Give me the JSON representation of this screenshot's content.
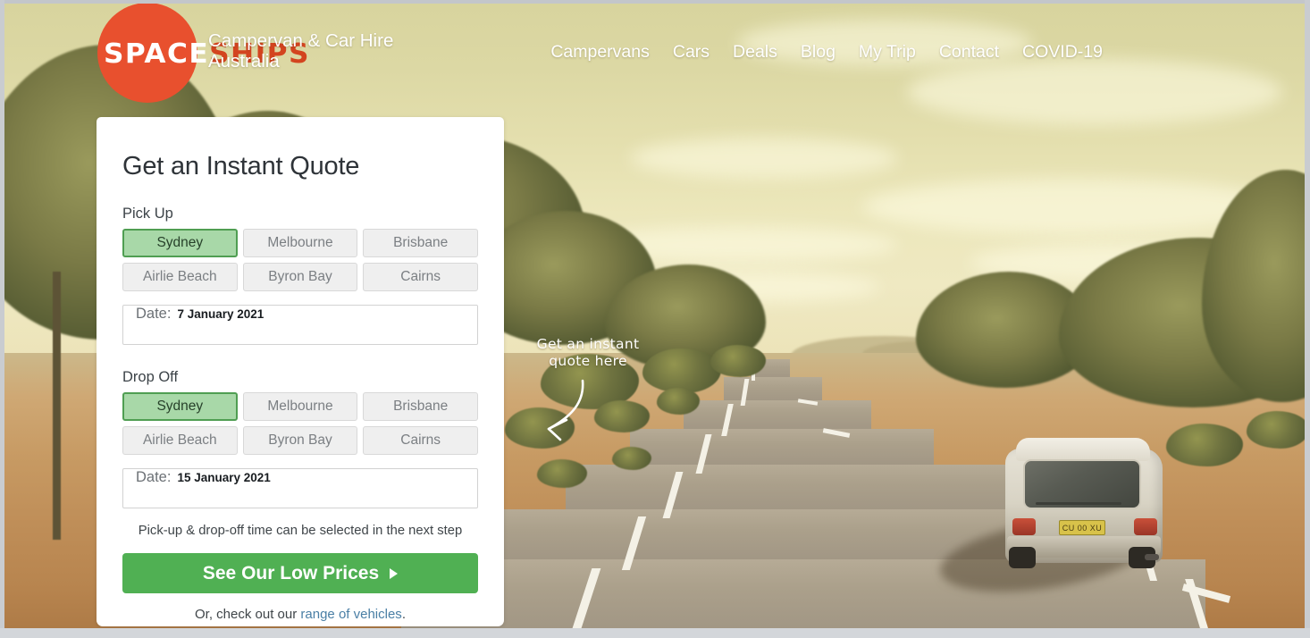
{
  "header": {
    "logo": {
      "word_primary": "SPACE",
      "word_secondary": "SHIPS",
      "circle_color": "#e8502e",
      "secondary_color": "#d3441f"
    },
    "tagline": "Campervan & Car Hire Australia",
    "nav": [
      {
        "label": "Campervans"
      },
      {
        "label": "Cars"
      },
      {
        "label": "Deals"
      },
      {
        "label": "Blog"
      },
      {
        "label": "My Trip"
      },
      {
        "label": "Contact"
      },
      {
        "label": "COVID-19"
      }
    ]
  },
  "annotation": {
    "line1": "Get an instant",
    "line2": "quote here",
    "color": "#ffffff",
    "icon": "curved-arrow-icon"
  },
  "quote_form": {
    "title": "Get an Instant Quote",
    "pickup": {
      "label": "Pick Up",
      "options": [
        {
          "label": "Sydney",
          "selected": true
        },
        {
          "label": "Melbourne",
          "selected": false
        },
        {
          "label": "Brisbane",
          "selected": false
        },
        {
          "label": "Airlie Beach",
          "selected": false
        },
        {
          "label": "Byron Bay",
          "selected": false
        },
        {
          "label": "Cairns",
          "selected": false
        }
      ],
      "date_label": "Date:",
      "date_value": "7 January 2021"
    },
    "dropoff": {
      "label": "Drop Off",
      "options": [
        {
          "label": "Sydney",
          "selected": true
        },
        {
          "label": "Melbourne",
          "selected": false
        },
        {
          "label": "Brisbane",
          "selected": false
        },
        {
          "label": "Airlie Beach",
          "selected": false
        },
        {
          "label": "Byron Bay",
          "selected": false
        },
        {
          "label": "Cairns",
          "selected": false
        }
      ],
      "date_label": "Date:",
      "date_value": "15 January 2021"
    },
    "helper_text": "Pick-up & drop-off time can be selected in the next step",
    "cta_label": "See Our Low Prices",
    "cta_icon": "play-triangle-icon",
    "cta_color": "#50b053",
    "footnote_prefix": "Or, check out our ",
    "footnote_link": "range of vehicles",
    "footnote_suffix": ".",
    "link_color": "#4a7fa5",
    "selected_color": "#a8d8a8",
    "selected_border_color": "#4f9e52"
  },
  "hero": {
    "alt": "Silver campervan driving on an outback highway at sunset",
    "license_plate": "CU 00 XU"
  }
}
